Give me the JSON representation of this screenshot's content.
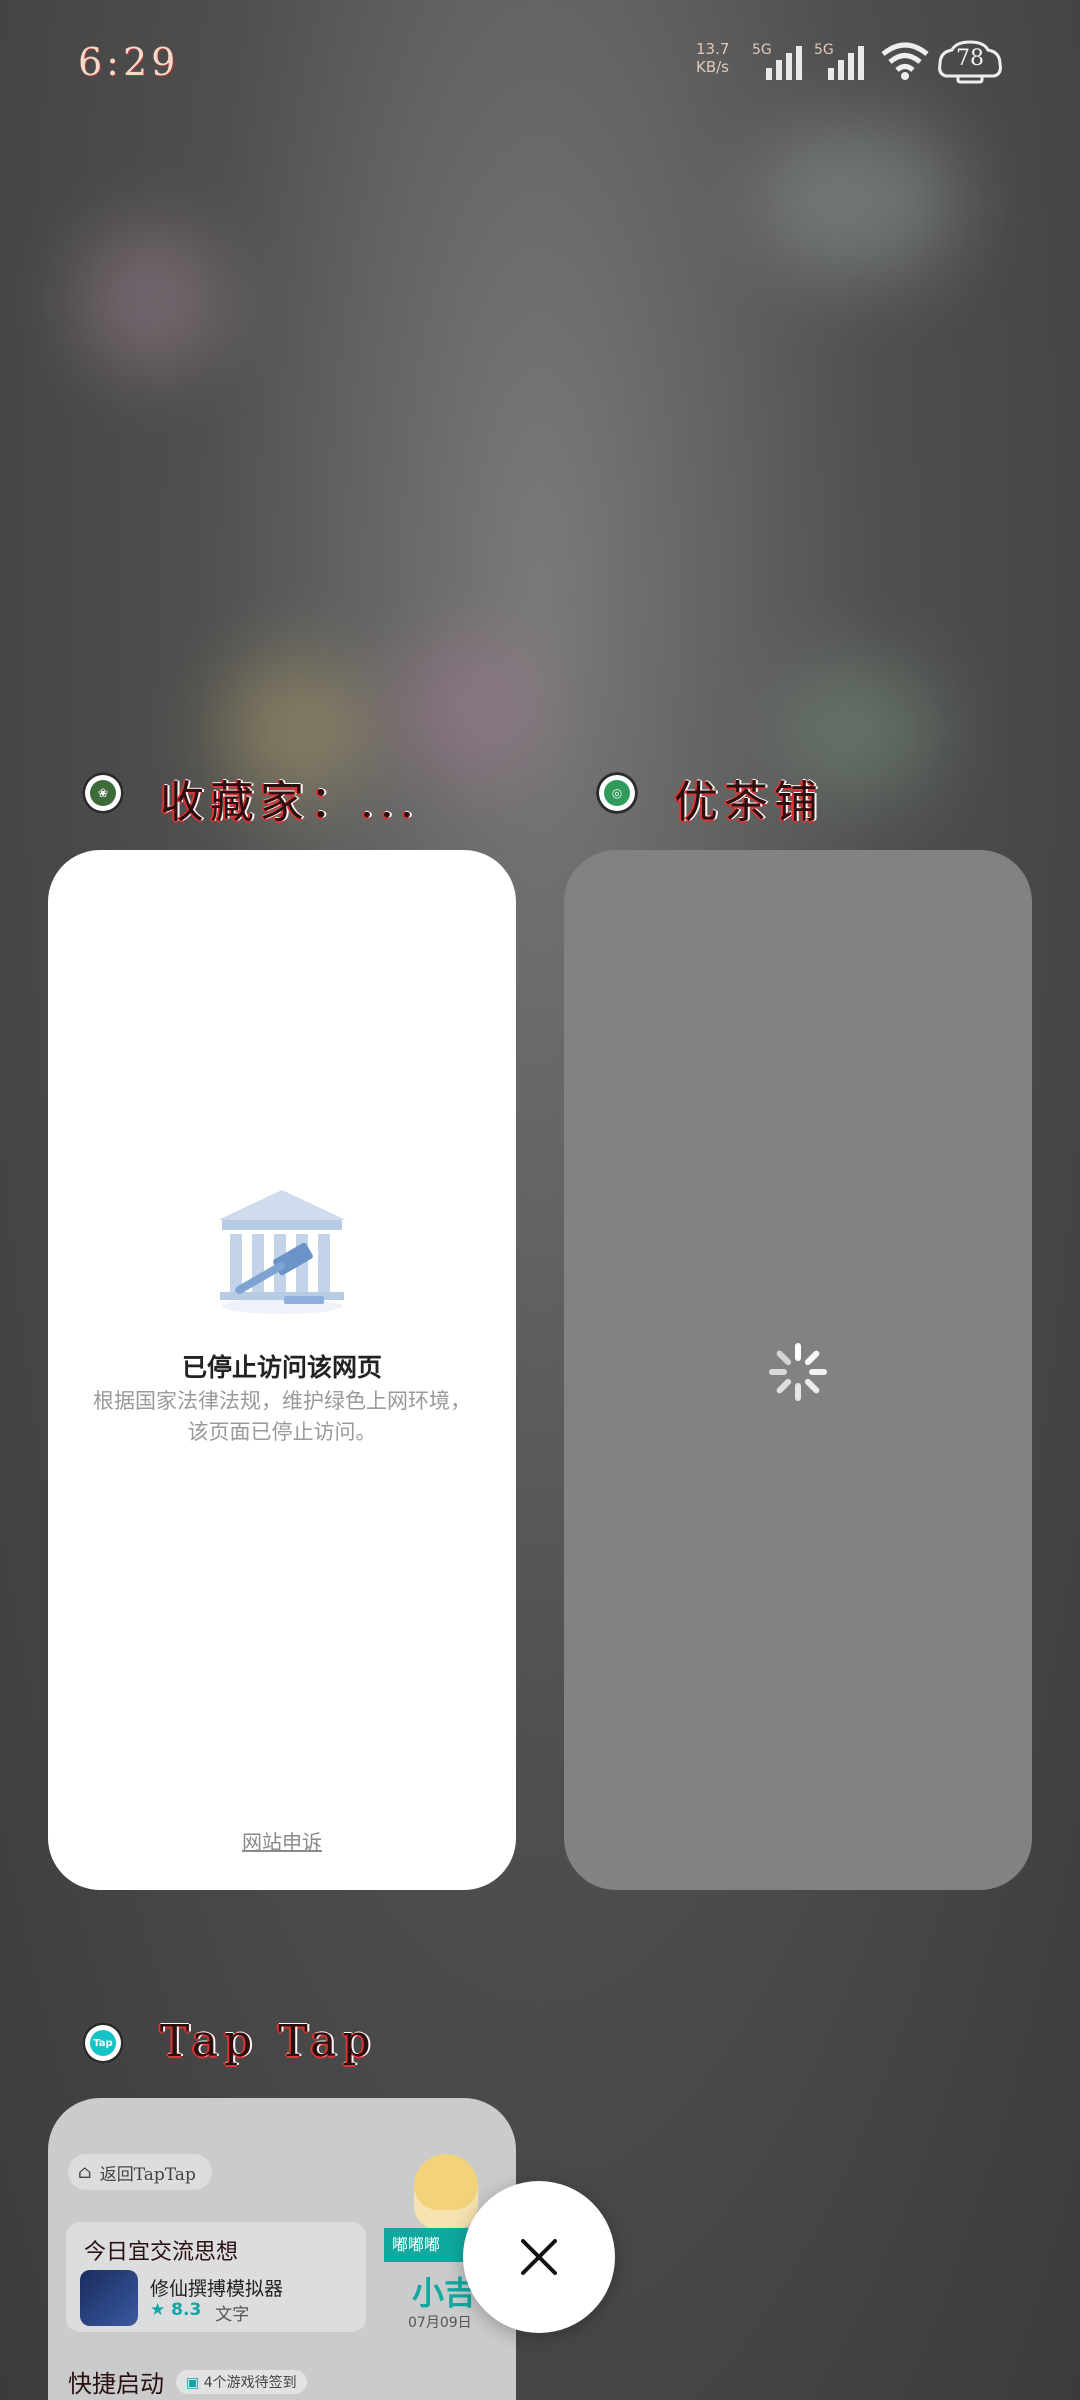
{
  "status_bar": {
    "time": "6:29",
    "net_speed_value": "13.7",
    "net_speed_unit": "KB/s",
    "sim1_type": "5G",
    "sim2_type": "5G",
    "battery": "78"
  },
  "recent_apps": [
    {
      "title": "收藏家：...",
      "icon": "collector-app-icon",
      "preview": {
        "notice_title": "已停止访问该网页",
        "notice_line1": "根据国家法律法规，维护绿色上网环境，",
        "notice_line2": "该页面已停止访问。",
        "appeal_link": "网站申诉"
      }
    },
    {
      "title": "优茶铺",
      "icon": "tea-shop-app-icon",
      "preview": {
        "state": "loading"
      }
    },
    {
      "title": "Tap Tap",
      "icon": "taptap-app-icon",
      "preview": {
        "back_button": "返回TapTap",
        "section_title": "今日宜交流思想",
        "game_name": "修仙撰搏模拟器",
        "game_rating": "8.3",
        "game_tag": "文字",
        "banner_tag": "嘟嘟嘟",
        "banner_name": "小吉",
        "banner_date": "07月09日",
        "quick_launch": "快捷启动",
        "quick_launch_badge": "4个游戏待签到"
      }
    }
  ],
  "controls": {
    "close_all": "close-icon"
  }
}
